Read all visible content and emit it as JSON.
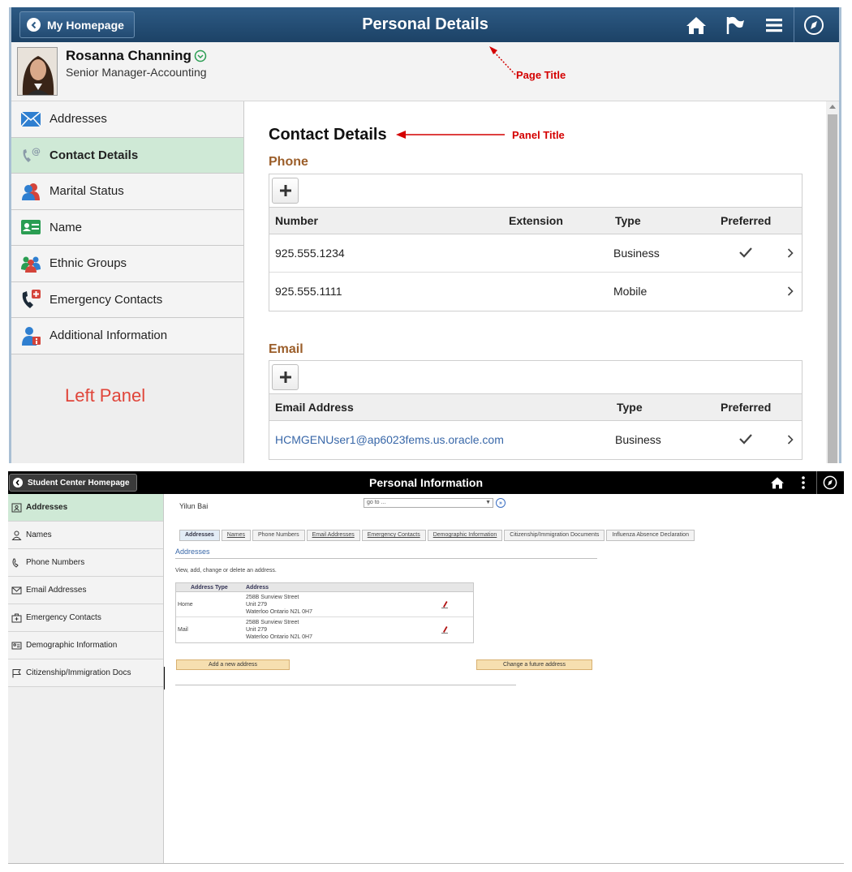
{
  "top": {
    "header": {
      "home_label": "My Homepage",
      "title": "Personal Details"
    },
    "person": {
      "name": "Rosanna Channing",
      "title": "Senior Manager-Accounting"
    },
    "annotations": {
      "page_title": "Page Title",
      "panel_title": "Panel Title",
      "left_panel": "Left Panel"
    },
    "sidebar": {
      "items": [
        {
          "label": "Addresses",
          "icon": "envelope-icon",
          "selected": false
        },
        {
          "label": "Contact Details",
          "icon": "contact-phone-icon",
          "selected": true
        },
        {
          "label": "Marital Status",
          "icon": "couple-icon",
          "selected": false
        },
        {
          "label": "Name",
          "icon": "id-card-icon",
          "selected": false
        },
        {
          "label": "Ethnic Groups",
          "icon": "group-icon",
          "selected": false
        },
        {
          "label": "Emergency Contacts",
          "icon": "emergency-phone-icon",
          "selected": false
        },
        {
          "label": "Additional Information",
          "icon": "person-info-icon",
          "selected": false
        }
      ]
    },
    "main": {
      "panel_title": "Contact Details",
      "phone": {
        "heading": "Phone",
        "columns": [
          "Number",
          "Extension",
          "Type",
          "Preferred"
        ],
        "rows": [
          {
            "number": "925.555.1234",
            "extension": "",
            "type": "Business",
            "preferred": true
          },
          {
            "number": "925.555.1111",
            "extension": "",
            "type": "Mobile",
            "preferred": false
          }
        ]
      },
      "email": {
        "heading": "Email",
        "columns": [
          "Email Address",
          "Type",
          "Preferred"
        ],
        "rows": [
          {
            "address": "HCMGENUser1@ap6023fems.us.oracle.com",
            "type": "Business",
            "preferred": true
          }
        ]
      }
    },
    "colors": {
      "header": "#1c4266",
      "selected": "#cfe9d6",
      "section": "#9b5e2a",
      "annotation": "#d40000"
    }
  },
  "bottom": {
    "header": {
      "home_label": "Student Center Homepage",
      "title": "Personal Information"
    },
    "sidebar": {
      "items": [
        {
          "label": "Addresses",
          "icon": "address-card-icon",
          "selected": true
        },
        {
          "label": "Names",
          "icon": "person-icon",
          "selected": false
        },
        {
          "label": "Phone Numbers",
          "icon": "phone-icon",
          "selected": false
        },
        {
          "label": "Email Addresses",
          "icon": "envelope-icon",
          "selected": false
        },
        {
          "label": "Emergency Contacts",
          "icon": "medical-bag-icon",
          "selected": false
        },
        {
          "label": "Demographic Information",
          "icon": "id-card-icon",
          "selected": false
        },
        {
          "label": "Citizenship/Immigration Docs",
          "icon": "flag-icon",
          "selected": false
        }
      ]
    },
    "main": {
      "student_name": "Yilun Bai",
      "goto_placeholder": "go to ...",
      "tabs": [
        "Addresses",
        "Names",
        "Phone Numbers",
        "Email Addresses",
        "Emergency Contacts",
        "Demographic Information",
        "Citizenship/Immigration Documents",
        "Influenza Absence Declaration"
      ],
      "section_title": "Addresses",
      "instructions": "View, add, change or delete an address.",
      "grid": {
        "columns": [
          "Address Type",
          "Address"
        ],
        "rows": [
          {
            "type": "Home",
            "lines": [
              "258B Sunview Street",
              "Unit 279",
              "Waterloo Ontario N2L 0H7"
            ]
          },
          {
            "type": "Mail",
            "lines": [
              "258B Sunview Street",
              "Unit 279",
              "Waterloo Ontario N2L 0H7"
            ]
          }
        ]
      },
      "add_button": "Add a new address",
      "future_button": "Change a future address"
    }
  }
}
